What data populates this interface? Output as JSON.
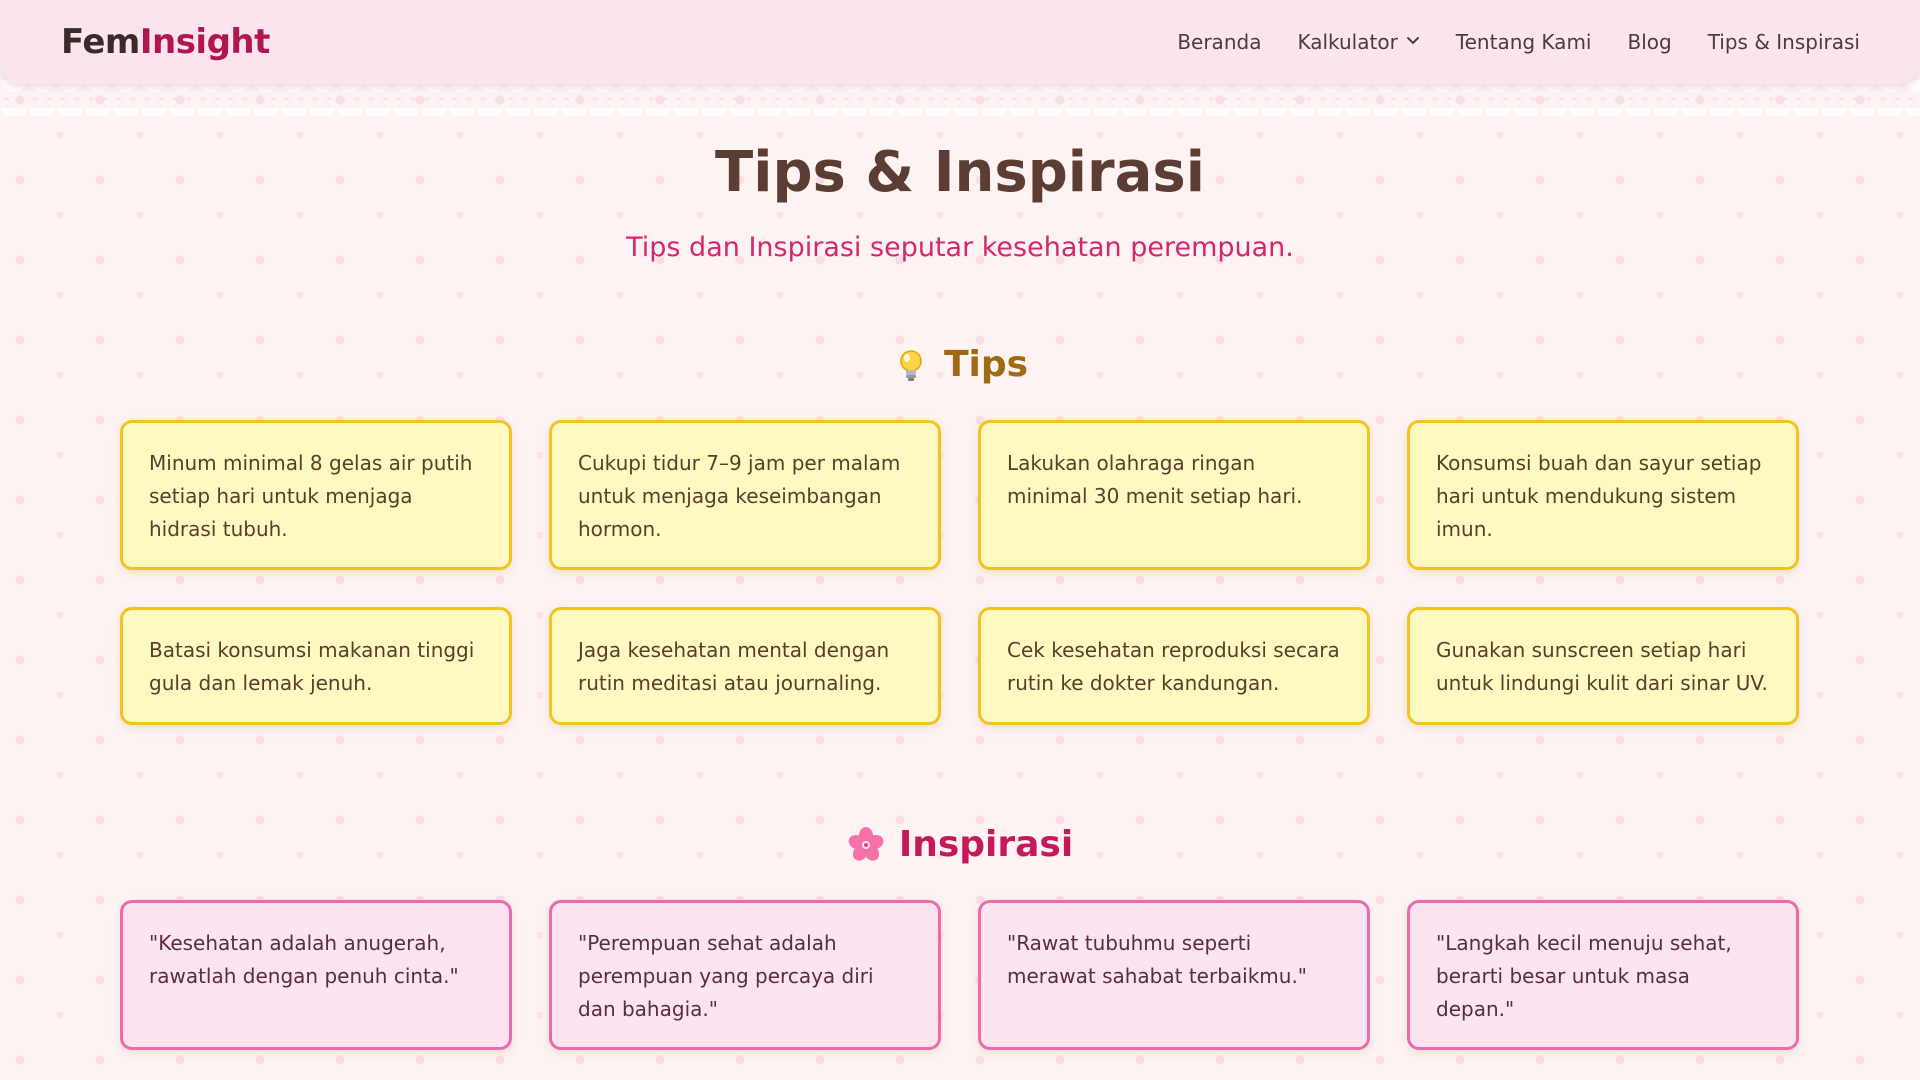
{
  "brand": {
    "part1": "Fem",
    "part2": "Insight"
  },
  "nav": {
    "items": [
      "Beranda",
      "Kalkulator",
      "Tentang Kami",
      "Blog",
      "Tips & Inspirasi"
    ]
  },
  "page": {
    "title": "Tips & Inspirasi",
    "subtitle": "Tips dan Inspirasi seputar kesehatan perempuan."
  },
  "tips": {
    "heading": "Tips",
    "icon": "lightbulb-icon",
    "items": [
      "Minum minimal 8 gelas air putih setiap hari untuk menjaga hidrasi tubuh.",
      "Cukupi tidur 7–9 jam per malam untuk menjaga keseimbangan hormon.",
      "Lakukan olahraga ringan minimal 30 menit setiap hari.",
      "Konsumsi buah dan sayur setiap hari untuk mendukung sistem imun.",
      "Batasi konsumsi makanan tinggi gula dan lemak jenuh.",
      "Jaga kesehatan mental dengan rutin meditasi atau journaling.",
      "Cek kesehatan reproduksi secara rutin ke dokter kandungan.",
      "Gunakan sunscreen setiap hari untuk lindungi kulit dari sinar UV."
    ]
  },
  "inspirasi": {
    "heading": "Inspirasi",
    "icon": "cherry-blossom-icon",
    "items": [
      "\"Kesehatan adalah anugerah, rawatlah dengan penuh cinta.\"",
      "\"Perempuan sehat adalah perempuan yang percaya diri dan bahagia.\"",
      "\"Rawat tubuhmu seperti merawat sahabat terbaikmu.\"",
      "\"Langkah kecil menuju sehat, berarti besar untuk masa depan.\""
    ]
  },
  "colors": {
    "brand_accent": "#b0174f",
    "title": "#5b3d33",
    "subtitle": "#d6266d",
    "tip_card_bg": "#fef9c0",
    "tip_card_border": "#f3c420",
    "quote_card_bg": "#fce4f1",
    "quote_card_border": "#ec6cab"
  }
}
